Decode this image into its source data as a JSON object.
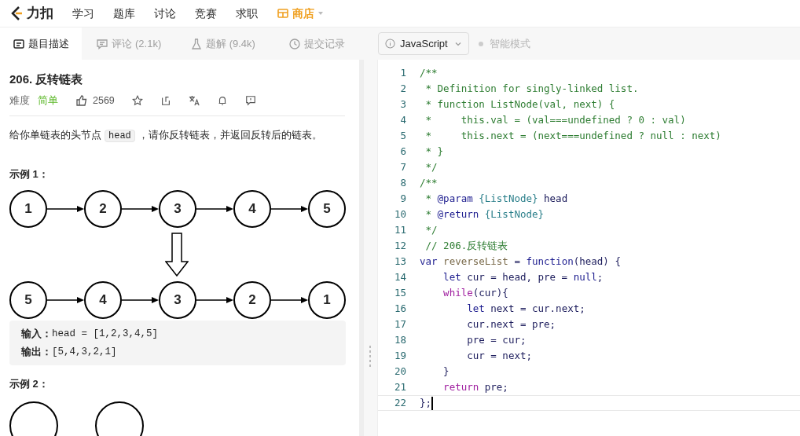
{
  "nav": {
    "logo": "力扣",
    "items": [
      {
        "label": "学习",
        "kind": "link"
      },
      {
        "label": "题库",
        "kind": "link"
      },
      {
        "label": "讨论",
        "kind": "link"
      },
      {
        "label": "竞赛",
        "kind": "link"
      },
      {
        "label": "求职",
        "kind": "link"
      },
      {
        "label": "商店",
        "kind": "store"
      }
    ]
  },
  "tabs": [
    {
      "label": "题目描述",
      "kind": "doc",
      "selected": true
    },
    {
      "label": "评论 (2.1k)",
      "kind": "comment",
      "selected": false
    },
    {
      "label": "题解 (9.4k)",
      "kind": "flask",
      "selected": false
    },
    {
      "label": "提交记录",
      "kind": "clock",
      "selected": false
    }
  ],
  "problem": {
    "title": "206. 反转链表",
    "difficulty_label": "难度",
    "difficulty": "简单",
    "likes": "2569",
    "description": [
      {
        "text": "给你单链表的头节点",
        "kind": "plain"
      },
      {
        "text": "head",
        "kind": "code"
      },
      {
        "text": "，请你反转链表，并返回反转后的链表。",
        "kind": "plain"
      }
    ],
    "example1": {
      "heading": "示例 1：",
      "top_nodes": [
        "1",
        "2",
        "3",
        "4",
        "5"
      ],
      "bottom_nodes": [
        "5",
        "4",
        "3",
        "2",
        "1"
      ],
      "input_label": "输入：",
      "input": "head = [1,2,3,4,5]",
      "output_label": "输出：",
      "output": "[5,4,3,2,1]"
    },
    "example2": {
      "heading": "示例 2："
    }
  },
  "editor": {
    "language": "JavaScript",
    "mode": "智能模式",
    "mode_on": false,
    "lines": [
      {
        "number": "1",
        "cursor": false,
        "tokens": [
          {
            "t": "/**",
            "kind": "comment"
          }
        ]
      },
      {
        "number": "2",
        "cursor": false,
        "tokens": [
          {
            "t": " * Definition for singly-linked list.",
            "kind": "comment"
          }
        ]
      },
      {
        "number": "3",
        "cursor": false,
        "tokens": [
          {
            "t": " * function ListNode(val, next) {",
            "kind": "comment"
          }
        ]
      },
      {
        "number": "4",
        "cursor": false,
        "tokens": [
          {
            "t": " *     this.val = (val===undefined ? 0 : val)",
            "kind": "comment"
          }
        ]
      },
      {
        "number": "5",
        "cursor": false,
        "tokens": [
          {
            "t": " *     this.next = (next===undefined ? null : next)",
            "kind": "comment"
          }
        ]
      },
      {
        "number": "6",
        "cursor": false,
        "tokens": [
          {
            "t": " * }",
            "kind": "comment"
          }
        ]
      },
      {
        "number": "7",
        "cursor": false,
        "tokens": [
          {
            "t": " */",
            "kind": "comment"
          }
        ]
      },
      {
        "number": "8",
        "cursor": false,
        "tokens": [
          {
            "t": "/**",
            "kind": "comment"
          }
        ]
      },
      {
        "number": "9",
        "cursor": false,
        "tokens": [
          {
            "t": " * ",
            "kind": "comment"
          },
          {
            "t": "@param",
            "kind": "tag"
          },
          {
            "t": " {ListNode}",
            "kind": "type"
          },
          {
            "t": " head",
            "kind": "plain"
          }
        ]
      },
      {
        "number": "10",
        "cursor": false,
        "tokens": [
          {
            "t": " * ",
            "kind": "comment"
          },
          {
            "t": "@return",
            "kind": "tag"
          },
          {
            "t": " {ListNode}",
            "kind": "type"
          }
        ]
      },
      {
        "number": "11",
        "cursor": false,
        "tokens": [
          {
            "t": " */",
            "kind": "comment"
          }
        ]
      },
      {
        "number": "12",
        "cursor": false,
        "tokens": [
          {
            "t": " // 206.反转链表",
            "kind": "comment"
          }
        ]
      },
      {
        "number": "13",
        "cursor": false,
        "tokens": [
          {
            "t": "var ",
            "kind": "keyword"
          },
          {
            "t": "reverseList",
            "kind": "def"
          },
          {
            "t": " = ",
            "kind": "plain"
          },
          {
            "t": "function",
            "kind": "keyword"
          },
          {
            "t": "(head) {",
            "kind": "plain"
          }
        ]
      },
      {
        "number": "14",
        "cursor": false,
        "tokens": [
          {
            "t": "    let",
            "kind": "keyword"
          },
          {
            "t": " cur = head, pre = ",
            "kind": "plain"
          },
          {
            "t": "null",
            "kind": "keyword"
          },
          {
            "t": ";",
            "kind": "plain"
          }
        ]
      },
      {
        "number": "15",
        "cursor": false,
        "tokens": [
          {
            "t": "    while",
            "kind": "control"
          },
          {
            "t": "(cur){",
            "kind": "plain"
          }
        ]
      },
      {
        "number": "16",
        "cursor": false,
        "tokens": [
          {
            "t": "        let",
            "kind": "keyword"
          },
          {
            "t": " next = cur.next;",
            "kind": "plain"
          }
        ]
      },
      {
        "number": "17",
        "cursor": false,
        "tokens": [
          {
            "t": "        cur.next = pre;",
            "kind": "plain"
          }
        ]
      },
      {
        "number": "18",
        "cursor": false,
        "tokens": [
          {
            "t": "        pre = cur;",
            "kind": "plain"
          }
        ]
      },
      {
        "number": "19",
        "cursor": false,
        "tokens": [
          {
            "t": "        cur = next;",
            "kind": "plain"
          }
        ]
      },
      {
        "number": "20",
        "cursor": false,
        "tokens": [
          {
            "t": "    }",
            "kind": "plain"
          }
        ]
      },
      {
        "number": "21",
        "cursor": false,
        "tokens": [
          {
            "t": "    return",
            "kind": "control"
          },
          {
            "t": " pre;",
            "kind": "plain"
          }
        ]
      },
      {
        "number": "22",
        "cursor": true,
        "tokens": [
          {
            "t": "};",
            "kind": "plain"
          }
        ]
      }
    ]
  }
}
